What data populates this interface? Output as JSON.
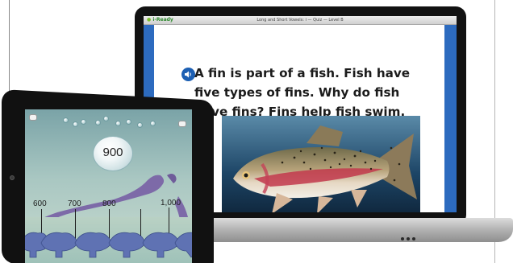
{
  "laptop": {
    "brand": "i-Ready",
    "window_title": "Long and Short Vowels: i — Quiz — Level B",
    "lesson_text": "A fin is part of a fish. Fish have five types of fins. Why do fish have fins? Fins help fish swim.",
    "speaker_icon": "speaker-icon",
    "photo": "rainbow-trout-photo"
  },
  "tablet": {
    "bubble_value": "900",
    "ruler_labels": [
      "600",
      "700",
      "800",
      "1,000"
    ],
    "corner_icons": [
      "home-icon",
      "pause-icon"
    ]
  },
  "colors": {
    "screen_blue": "#2d6bbf",
    "speaker_blue": "#1c5fb3",
    "brand_green": "#2f8a2f"
  }
}
